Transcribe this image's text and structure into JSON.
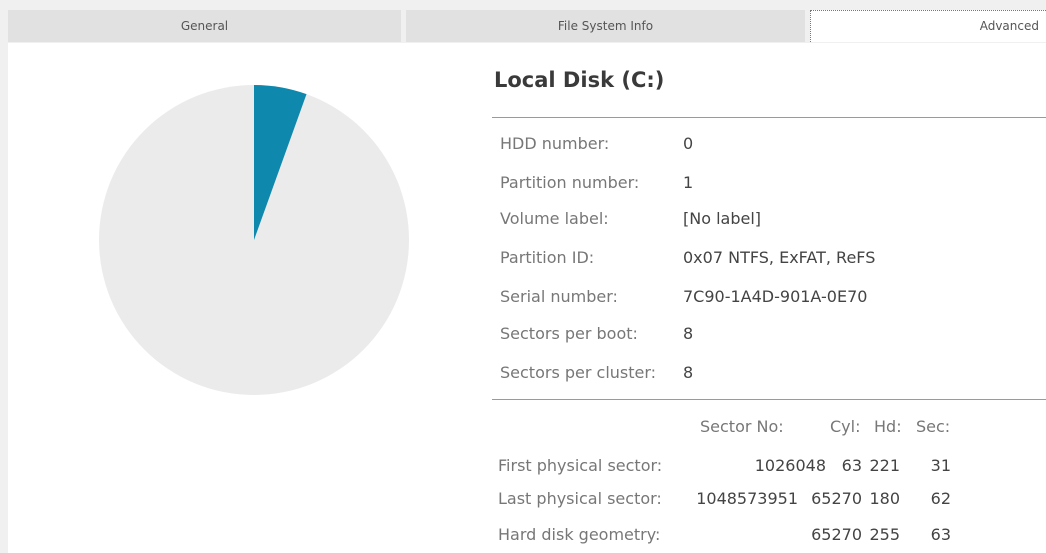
{
  "tabs": [
    {
      "label": "General"
    },
    {
      "label": "File System Info"
    },
    {
      "label": "Advanced",
      "active": true
    }
  ],
  "pie": {
    "used_fraction": 0.055,
    "used_color": "#0f88ad",
    "free_color": "#ebebeb"
  },
  "disk_title": "Local Disk (C:)",
  "info": [
    {
      "label": "HDD number:",
      "value": "0"
    },
    {
      "label": "Partition number:",
      "value": "1"
    },
    {
      "label": "Volume label:",
      "value": "[No label]"
    },
    {
      "label": "Partition ID:",
      "value": "0x07 NTFS, ExFAT, ReFS"
    },
    {
      "label": "Serial number:",
      "value": "7C90-1A4D-901A-0E70"
    },
    {
      "label": "Sectors per boot:",
      "value": "8"
    },
    {
      "label": "Sectors per cluster:",
      "value": "8"
    }
  ],
  "geometry": {
    "headers": {
      "sector": "Sector No:",
      "cyl": "Cyl:",
      "hd": "Hd:",
      "sec": "Sec:"
    },
    "rows": [
      {
        "label": "First physical sector:",
        "sector": "1026048",
        "cyl": "63",
        "hd": "221",
        "sec": "31"
      },
      {
        "label": "Last physical sector:",
        "sector": "1048573951",
        "cyl": "65270",
        "hd": "180",
        "sec": "62"
      },
      {
        "label": "Hard disk geometry:",
        "sector": "",
        "cyl": "65270",
        "hd": "255",
        "sec": "63"
      }
    ]
  }
}
